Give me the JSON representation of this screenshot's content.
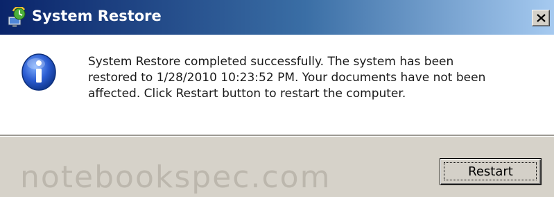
{
  "window": {
    "title": "System Restore",
    "close_symbol": "×"
  },
  "message": {
    "lines": [
      "System Restore completed successfully. The system has been",
      "restored to 1/28/2010 10:23:52 PM. Your documents have not been",
      "affected. Click Restart button to restart the computer."
    ]
  },
  "buttons": {
    "restart_label": "Restart"
  },
  "watermark": "notebookspec.com",
  "icons": {
    "title_icon": "system-restore-icon",
    "message_icon": "info-icon",
    "close_icon": "close-icon"
  },
  "colors": {
    "titlebar_start": "#0a246a",
    "titlebar_end": "#a6caf0",
    "button_face": "#d4d0c8",
    "info_blue": "#2a5bd0"
  }
}
